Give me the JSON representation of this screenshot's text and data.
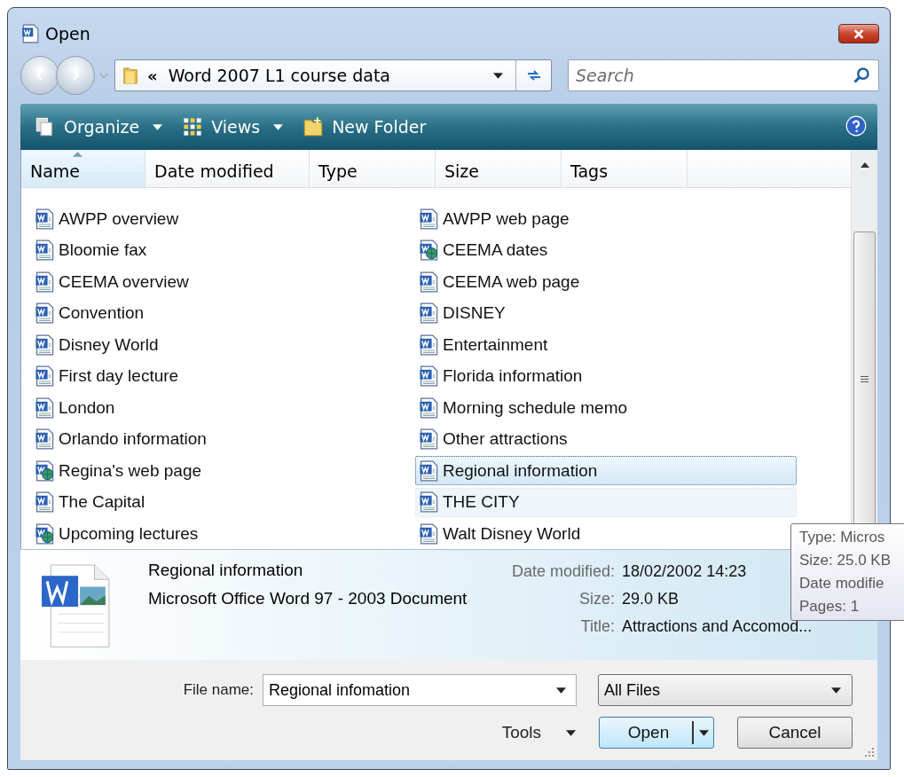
{
  "window": {
    "title": "Open"
  },
  "nav": {
    "path_prefix": "«",
    "path": "Word 2007 L1 course data",
    "search_placeholder": "Search"
  },
  "toolbar": [
    {
      "label": "Organize",
      "kind": "organize"
    },
    {
      "label": "Views",
      "kind": "views"
    },
    {
      "label": "New Folder",
      "kind": "folder"
    }
  ],
  "columns": [
    "Name",
    "Date modified",
    "Type",
    "Size",
    "Tags"
  ],
  "files": [
    {
      "name": "AWPP overview",
      "kind": "doc",
      "selected": false,
      "hovered": false
    },
    {
      "name": "Bloomie fax",
      "kind": "doc",
      "selected": false,
      "hovered": false
    },
    {
      "name": "CEEMA overview",
      "kind": "doc",
      "selected": false,
      "hovered": false
    },
    {
      "name": "Convention",
      "kind": "doc",
      "selected": false,
      "hovered": false
    },
    {
      "name": "Disney World",
      "kind": "doc",
      "selected": false,
      "hovered": false
    },
    {
      "name": "First day lecture",
      "kind": "doc",
      "selected": false,
      "hovered": false
    },
    {
      "name": "London",
      "kind": "doc",
      "selected": false,
      "hovered": false
    },
    {
      "name": "Orlando information",
      "kind": "doc",
      "selected": false,
      "hovered": false
    },
    {
      "name": "Regina's web page",
      "kind": "web",
      "selected": false,
      "hovered": false
    },
    {
      "name": "The Capital",
      "kind": "doc",
      "selected": false,
      "hovered": false
    },
    {
      "name": "Upcoming lectures",
      "kind": "web",
      "selected": false,
      "hovered": false
    },
    {
      "name": "AWPP web page",
      "kind": "doc",
      "selected": false,
      "hovered": false
    },
    {
      "name": "CEEMA dates",
      "kind": "web",
      "selected": false,
      "hovered": false
    },
    {
      "name": "CEEMA web page",
      "kind": "doc",
      "selected": false,
      "hovered": false
    },
    {
      "name": "DISNEY",
      "kind": "doc",
      "selected": false,
      "hovered": false
    },
    {
      "name": "Entertainment",
      "kind": "doc",
      "selected": false,
      "hovered": false
    },
    {
      "name": "Florida information",
      "kind": "doc",
      "selected": false,
      "hovered": false
    },
    {
      "name": "Morning schedule memo",
      "kind": "doc",
      "selected": false,
      "hovered": false
    },
    {
      "name": "Other attractions",
      "kind": "doc",
      "selected": false,
      "hovered": false
    },
    {
      "name": "Regional information",
      "kind": "doc",
      "selected": true,
      "hovered": false
    },
    {
      "name": "THE CITY",
      "kind": "doc",
      "selected": false,
      "hovered": true
    },
    {
      "name": "Walt Disney World",
      "kind": "doc",
      "selected": false,
      "hovered": false
    }
  ],
  "tooltip": [
    "Type: Micros",
    "Size: 25.0 KB",
    "Date modifie",
    "Pages: 1"
  ],
  "details": {
    "name": "Regional information",
    "type": "Microsoft Office Word 97 - 2003 Document",
    "fields": [
      {
        "label": "Date modified:",
        "value": "18/02/2002 14:23"
      },
      {
        "label": "Size:",
        "value": "29.0 KB"
      },
      {
        "label": "Title:",
        "value": "Attractions and Accomod..."
      }
    ]
  },
  "file_name": {
    "label": "File name:",
    "value": "Regional infomation"
  },
  "filter": "All Files",
  "buttons": {
    "tools": "Tools",
    "open": "Open",
    "cancel": "Cancel"
  }
}
